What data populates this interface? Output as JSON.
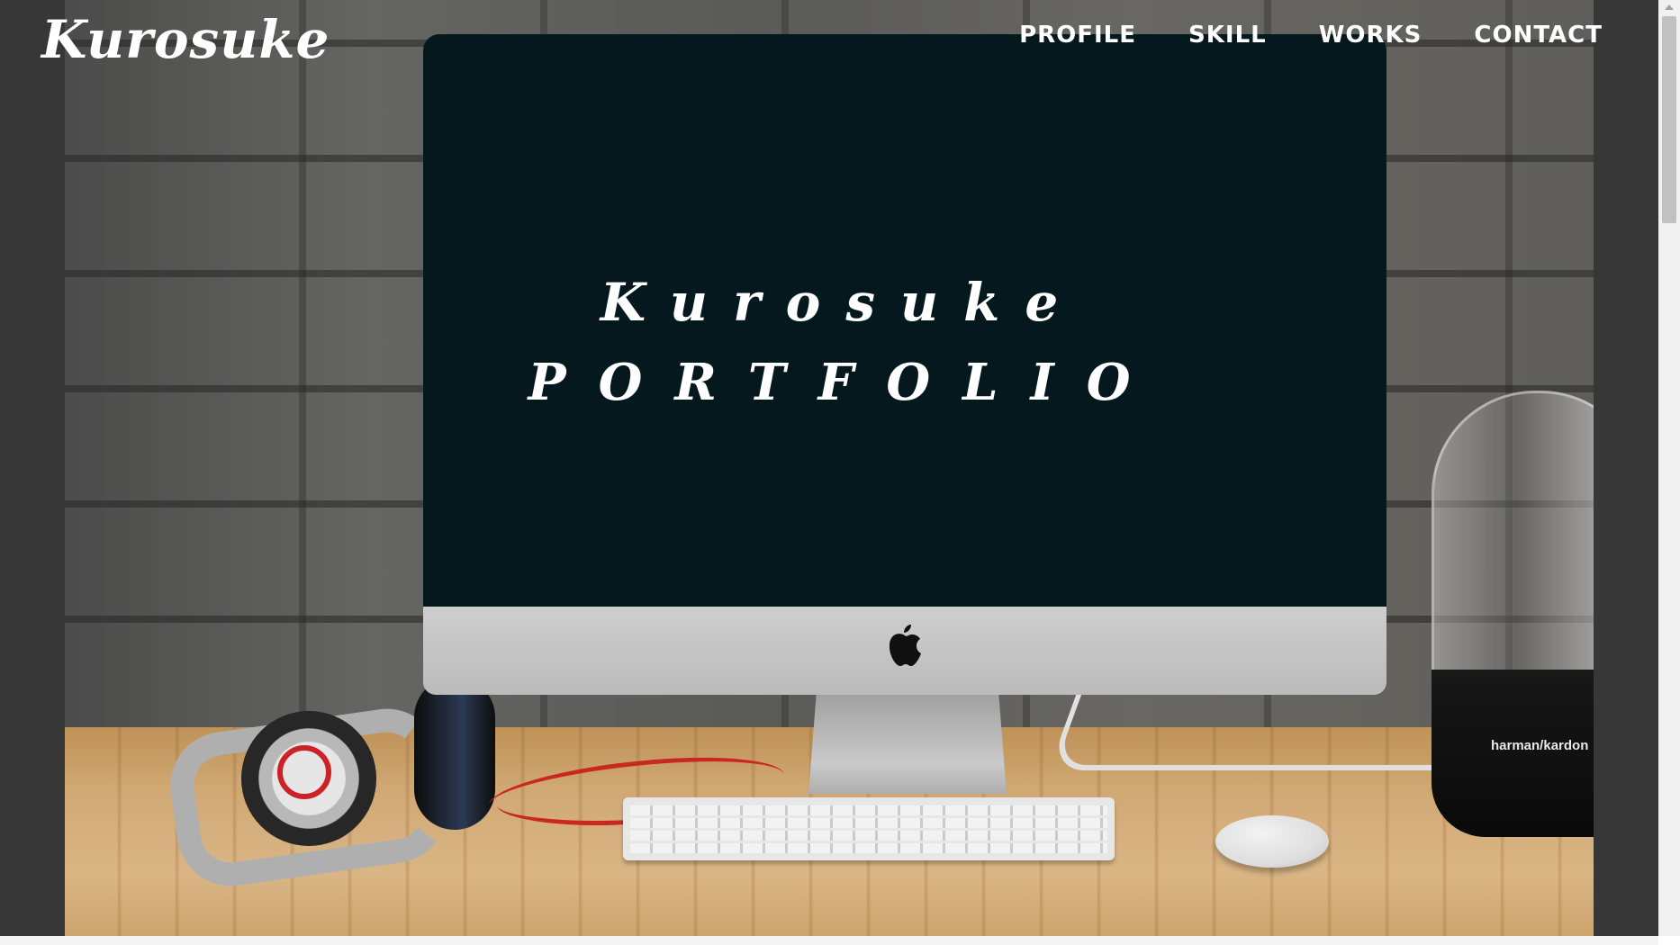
{
  "header": {
    "logo": "Kurosuke",
    "nav": [
      {
        "label": "PROFILE"
      },
      {
        "label": "SKILL"
      },
      {
        "label": "WORKS"
      },
      {
        "label": "CONTACT"
      }
    ]
  },
  "hero": {
    "title_line1": "Kurosuke",
    "title_line2": "PORTFOLIO",
    "speaker_brand": "harman/kardon"
  }
}
